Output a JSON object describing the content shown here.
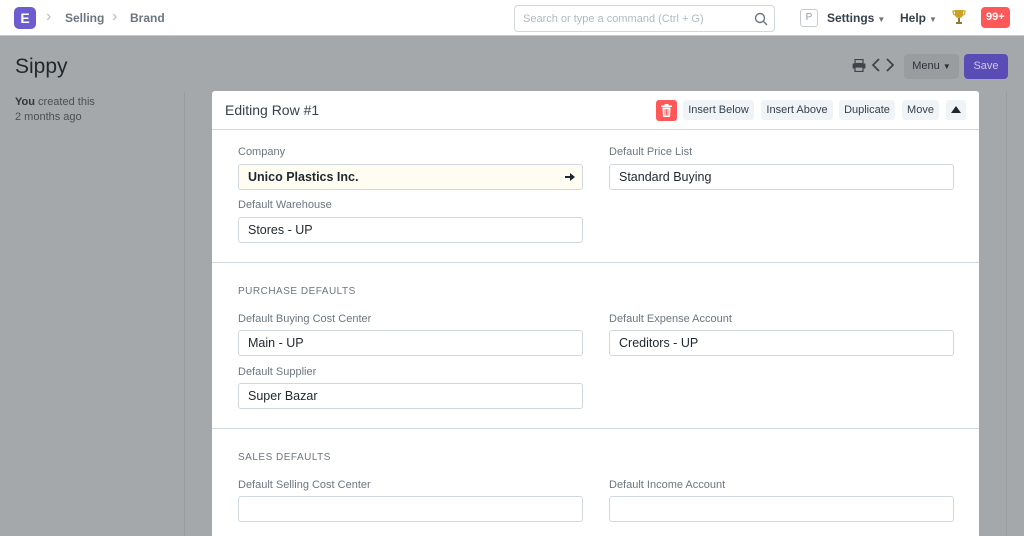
{
  "navbar": {
    "logo_letter": "E",
    "breadcrumbs": [
      "Selling",
      "Brand"
    ],
    "search_placeholder": "Search or type a command (Ctrl + G)",
    "p_icon_letter": "P",
    "settings_label": "Settings",
    "help_label": "Help",
    "notification_count": "99+"
  },
  "page": {
    "title": "Sippy",
    "menu_label": "Menu",
    "save_label": "Save",
    "timeline_user": "You",
    "timeline_action": "created this",
    "timeline_time": "2 months ago"
  },
  "panel": {
    "title": "Editing Row #1",
    "buttons": {
      "insert_below": "Insert Below",
      "insert_above": "Insert Above",
      "duplicate": "Duplicate",
      "move": "Move"
    },
    "section1": {
      "company_label": "Company",
      "company_value": "Unico Plastics Inc.",
      "default_price_list_label": "Default Price List",
      "default_price_list_value": "Standard Buying",
      "default_warehouse_label": "Default Warehouse",
      "default_warehouse_value": "Stores - UP"
    },
    "purchase": {
      "heading": "PURCHASE DEFAULTS",
      "buying_cost_center_label": "Default Buying Cost Center",
      "buying_cost_center_value": "Main - UP",
      "expense_account_label": "Default Expense Account",
      "expense_account_value": "Creditors - UP",
      "supplier_label": "Default Supplier",
      "supplier_value": "Super Bazar"
    },
    "sales": {
      "heading": "SALES DEFAULTS",
      "selling_cost_center_label": "Default Selling Cost Center",
      "selling_cost_center_value": "",
      "income_account_label": "Default Income Account",
      "income_account_value": ""
    }
  },
  "colors": {
    "brand": "#6d5bd0",
    "danger": "#ff5858",
    "overlay": "#a5a8aa"
  }
}
